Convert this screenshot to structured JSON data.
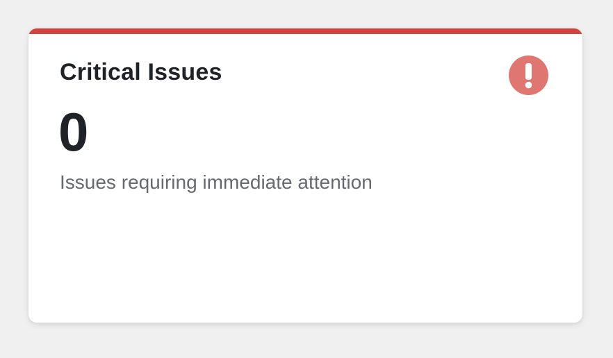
{
  "card": {
    "title": "Critical Issues",
    "value": "0",
    "description": "Issues requiring immediate attention",
    "icon": "exclamation-circle-icon"
  },
  "colors": {
    "accent": "#d3433f",
    "icon_bg": "#df7672",
    "text_primary": "#1f2328",
    "text_secondary": "#666a70",
    "background": "#f0f0f0",
    "card_bg": "#ffffff"
  }
}
